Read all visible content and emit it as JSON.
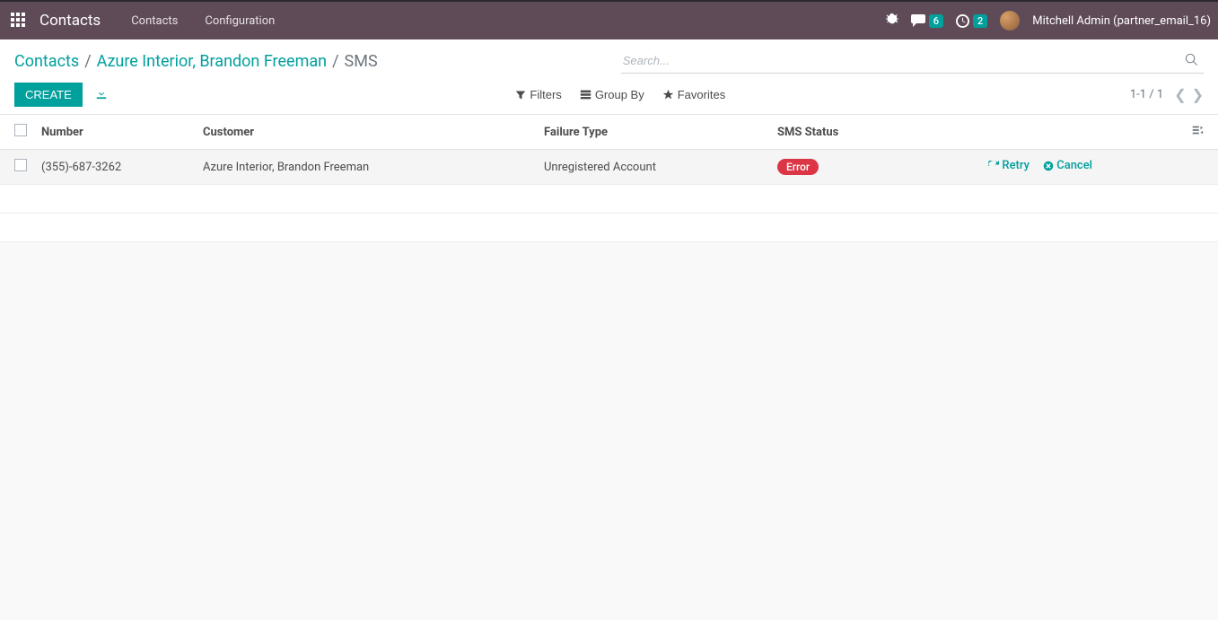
{
  "topbar": {
    "app_title": "Contacts",
    "nav": {
      "contacts": "Contacts",
      "configuration": "Configuration"
    },
    "messages_count": "6",
    "activities_count": "2",
    "username": "Mitchell Admin (partner_email_16)"
  },
  "breadcrumb": {
    "root": "Contacts",
    "parent": "Azure Interior, Brandon Freeman",
    "current": "SMS"
  },
  "search": {
    "placeholder": "Search..."
  },
  "buttons": {
    "create": "CREATE"
  },
  "filters": {
    "filters": "Filters",
    "groupby": "Group By",
    "favorites": "Favorites"
  },
  "pager": {
    "range": "1-1 / 1"
  },
  "columns": {
    "number": "Number",
    "customer": "Customer",
    "failure_type": "Failure Type",
    "sms_status": "SMS Status"
  },
  "rows": [
    {
      "number": "(355)-687-3262",
      "customer": "Azure Interior, Brandon Freeman",
      "failure_type": "Unregistered Account",
      "status": "Error",
      "retry": "Retry",
      "cancel": "Cancel"
    }
  ]
}
